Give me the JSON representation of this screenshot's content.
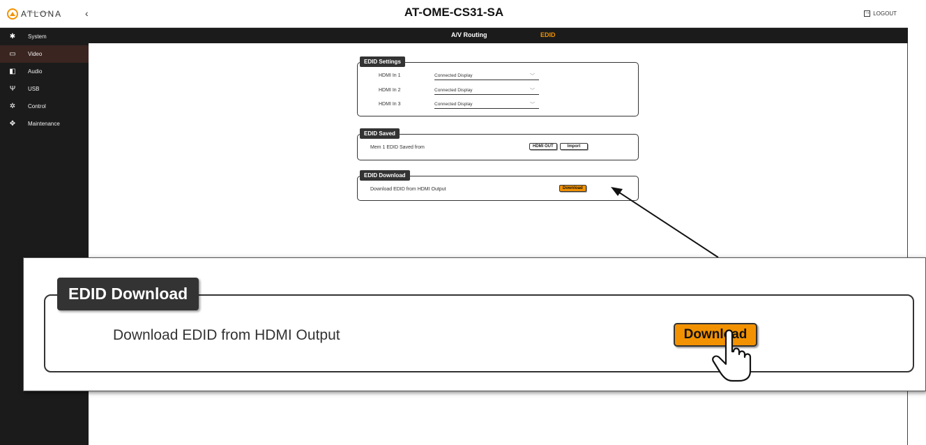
{
  "header": {
    "title": "AT-OME-CS31-SA",
    "logo_text": "ATLONA",
    "logo_sub": "a Panduit company",
    "collapse_glyph": "‹",
    "logout_label": "LOGOUT"
  },
  "sidebar": {
    "items": [
      {
        "label": "System",
        "icon": "gear-icon"
      },
      {
        "label": "Video",
        "icon": "monitor-icon"
      },
      {
        "label": "Audio",
        "icon": "speaker-icon"
      },
      {
        "label": "USB",
        "icon": "usb-icon"
      },
      {
        "label": "Control",
        "icon": "network-icon"
      },
      {
        "label": "Maintenance",
        "icon": "move-icon"
      }
    ],
    "active": "Video"
  },
  "tabs": {
    "routing": "A/V Routing",
    "edid": "EDID",
    "active": "EDID"
  },
  "edid_settings": {
    "title": "EDID Settings",
    "rows": [
      {
        "label": "HDMI In 1",
        "value": "Connected Display"
      },
      {
        "label": "HDMI In 2",
        "value": "Connected Display"
      },
      {
        "label": "HDMI In 3",
        "value": "Connected Display"
      }
    ]
  },
  "edid_saved": {
    "title": "EDID Saved",
    "label": "Mem 1 EDID Saved from",
    "source_button": "HDMI OUT",
    "import_button": "Import"
  },
  "edid_download": {
    "title": "EDID Download",
    "label": "Download EDID from HDMI Output",
    "button": "Download"
  },
  "colors": {
    "accent": "#f39200",
    "sidebar_bg": "#1b1b1b",
    "active_item_bg": "#3a2520"
  }
}
